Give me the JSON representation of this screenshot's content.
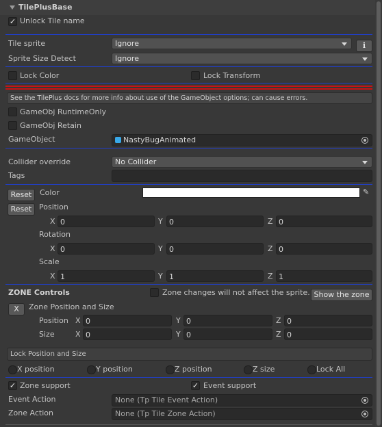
{
  "header": {
    "title": "TilePlusBase",
    "unlock_label": "Unlock Tile name",
    "unlock_checked": true
  },
  "tile_sprite": {
    "label": "Tile sprite",
    "value": "Ignore",
    "info_icon": "info-icon"
  },
  "sprite_size": {
    "label": "Sprite Size Detect",
    "value": "Ignore"
  },
  "locks": {
    "lock_color": "Lock Color",
    "lock_transform": "Lock Transform"
  },
  "gameobject": {
    "note": "See the TilePlus docs for more info about use of the GameObject options; can cause errors.",
    "runtime_only": "GameObj RuntimeOnly",
    "retain": "GameObj Retain",
    "label": "GameObject",
    "value": "NastyBugAnimated"
  },
  "collider": {
    "label": "Collider override",
    "value": "No Collider"
  },
  "tags": {
    "label": "Tags",
    "value": ""
  },
  "transform": {
    "reset_label": "Reset",
    "color_label": "Color",
    "color_value": "#ffffff",
    "position_label": "Position",
    "rotation_label": "Rotation",
    "scale_label": "Scale",
    "axis_x": "X",
    "axis_y": "Y",
    "axis_z": "Z",
    "position": [
      "0",
      "0",
      "0"
    ],
    "rotation": [
      "0",
      "0",
      "0"
    ],
    "scale": [
      "1",
      "1",
      "1"
    ]
  },
  "zone": {
    "title": "ZONE Controls",
    "no_affect": "Zone changes will not affect the sprite.",
    "show_button": "Show the zone",
    "x_button": "X",
    "pos_size_label": "Zone Position and Size",
    "position_label": "Position",
    "size_label": "Size",
    "position": [
      "0",
      "0",
      "0"
    ],
    "size": [
      "0",
      "0",
      "0"
    ],
    "lock_header": "Lock Position and Size",
    "x_position": "X position",
    "y_position": "Y position",
    "z_position": "Z position",
    "z_size": "Z size",
    "lock_all": "Lock All"
  },
  "support": {
    "zone_support": "Zone support",
    "event_support": "Event support",
    "zone_checked": true,
    "event_checked": true,
    "event_action_label": "Event Action",
    "event_action_value": "None (Tp Tile Event Action)",
    "zone_action_label": "Zone Action",
    "zone_action_value": "None (Tp Tile Zone Action)"
  },
  "colors": {
    "separator": "#1f3fcf",
    "warning_line": "#c81414",
    "object_icon": "#38a8e8"
  }
}
